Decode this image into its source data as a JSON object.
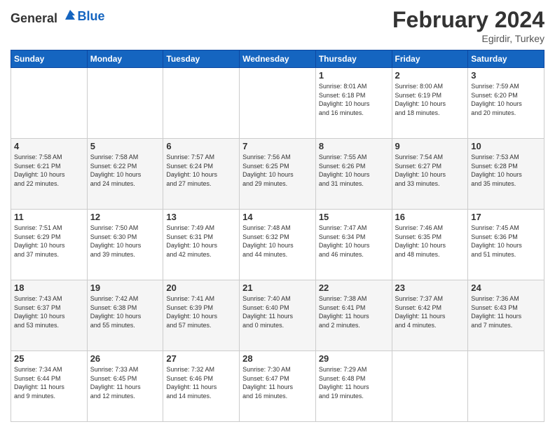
{
  "header": {
    "logo_general": "General",
    "logo_blue": "Blue",
    "title": "February 2024",
    "location": "Egirdir, Turkey"
  },
  "weekdays": [
    "Sunday",
    "Monday",
    "Tuesday",
    "Wednesday",
    "Thursday",
    "Friday",
    "Saturday"
  ],
  "weeks": [
    [
      {
        "day": "",
        "info": ""
      },
      {
        "day": "",
        "info": ""
      },
      {
        "day": "",
        "info": ""
      },
      {
        "day": "",
        "info": ""
      },
      {
        "day": "1",
        "info": "Sunrise: 8:01 AM\nSunset: 6:18 PM\nDaylight: 10 hours\nand 16 minutes."
      },
      {
        "day": "2",
        "info": "Sunrise: 8:00 AM\nSunset: 6:19 PM\nDaylight: 10 hours\nand 18 minutes."
      },
      {
        "day": "3",
        "info": "Sunrise: 7:59 AM\nSunset: 6:20 PM\nDaylight: 10 hours\nand 20 minutes."
      }
    ],
    [
      {
        "day": "4",
        "info": "Sunrise: 7:58 AM\nSunset: 6:21 PM\nDaylight: 10 hours\nand 22 minutes."
      },
      {
        "day": "5",
        "info": "Sunrise: 7:58 AM\nSunset: 6:22 PM\nDaylight: 10 hours\nand 24 minutes."
      },
      {
        "day": "6",
        "info": "Sunrise: 7:57 AM\nSunset: 6:24 PM\nDaylight: 10 hours\nand 27 minutes."
      },
      {
        "day": "7",
        "info": "Sunrise: 7:56 AM\nSunset: 6:25 PM\nDaylight: 10 hours\nand 29 minutes."
      },
      {
        "day": "8",
        "info": "Sunrise: 7:55 AM\nSunset: 6:26 PM\nDaylight: 10 hours\nand 31 minutes."
      },
      {
        "day": "9",
        "info": "Sunrise: 7:54 AM\nSunset: 6:27 PM\nDaylight: 10 hours\nand 33 minutes."
      },
      {
        "day": "10",
        "info": "Sunrise: 7:53 AM\nSunset: 6:28 PM\nDaylight: 10 hours\nand 35 minutes."
      }
    ],
    [
      {
        "day": "11",
        "info": "Sunrise: 7:51 AM\nSunset: 6:29 PM\nDaylight: 10 hours\nand 37 minutes."
      },
      {
        "day": "12",
        "info": "Sunrise: 7:50 AM\nSunset: 6:30 PM\nDaylight: 10 hours\nand 39 minutes."
      },
      {
        "day": "13",
        "info": "Sunrise: 7:49 AM\nSunset: 6:31 PM\nDaylight: 10 hours\nand 42 minutes."
      },
      {
        "day": "14",
        "info": "Sunrise: 7:48 AM\nSunset: 6:32 PM\nDaylight: 10 hours\nand 44 minutes."
      },
      {
        "day": "15",
        "info": "Sunrise: 7:47 AM\nSunset: 6:34 PM\nDaylight: 10 hours\nand 46 minutes."
      },
      {
        "day": "16",
        "info": "Sunrise: 7:46 AM\nSunset: 6:35 PM\nDaylight: 10 hours\nand 48 minutes."
      },
      {
        "day": "17",
        "info": "Sunrise: 7:45 AM\nSunset: 6:36 PM\nDaylight: 10 hours\nand 51 minutes."
      }
    ],
    [
      {
        "day": "18",
        "info": "Sunrise: 7:43 AM\nSunset: 6:37 PM\nDaylight: 10 hours\nand 53 minutes."
      },
      {
        "day": "19",
        "info": "Sunrise: 7:42 AM\nSunset: 6:38 PM\nDaylight: 10 hours\nand 55 minutes."
      },
      {
        "day": "20",
        "info": "Sunrise: 7:41 AM\nSunset: 6:39 PM\nDaylight: 10 hours\nand 57 minutes."
      },
      {
        "day": "21",
        "info": "Sunrise: 7:40 AM\nSunset: 6:40 PM\nDaylight: 11 hours\nand 0 minutes."
      },
      {
        "day": "22",
        "info": "Sunrise: 7:38 AM\nSunset: 6:41 PM\nDaylight: 11 hours\nand 2 minutes."
      },
      {
        "day": "23",
        "info": "Sunrise: 7:37 AM\nSunset: 6:42 PM\nDaylight: 11 hours\nand 4 minutes."
      },
      {
        "day": "24",
        "info": "Sunrise: 7:36 AM\nSunset: 6:43 PM\nDaylight: 11 hours\nand 7 minutes."
      }
    ],
    [
      {
        "day": "25",
        "info": "Sunrise: 7:34 AM\nSunset: 6:44 PM\nDaylight: 11 hours\nand 9 minutes."
      },
      {
        "day": "26",
        "info": "Sunrise: 7:33 AM\nSunset: 6:45 PM\nDaylight: 11 hours\nand 12 minutes."
      },
      {
        "day": "27",
        "info": "Sunrise: 7:32 AM\nSunset: 6:46 PM\nDaylight: 11 hours\nand 14 minutes."
      },
      {
        "day": "28",
        "info": "Sunrise: 7:30 AM\nSunset: 6:47 PM\nDaylight: 11 hours\nand 16 minutes."
      },
      {
        "day": "29",
        "info": "Sunrise: 7:29 AM\nSunset: 6:48 PM\nDaylight: 11 hours\nand 19 minutes."
      },
      {
        "day": "",
        "info": ""
      },
      {
        "day": "",
        "info": ""
      }
    ]
  ]
}
